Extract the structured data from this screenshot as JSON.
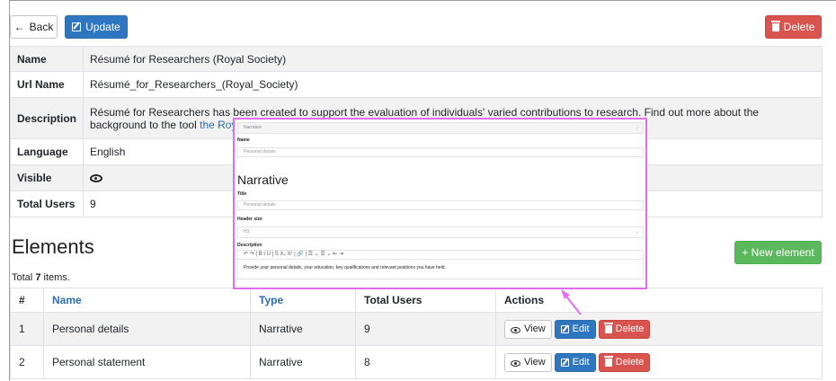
{
  "toolbar": {
    "back_label": "Back",
    "update_label": "Update",
    "delete_label": "Delete"
  },
  "details": {
    "name_label": "Name",
    "name_value": "Résumé for Researchers (Royal Society)",
    "url_label": "Url Name",
    "url_value": "Résumé_for_Researchers_(Royal_Society)",
    "desc_label": "Description",
    "desc_text": "Résumé for Researchers has been created to support the evaluation of individuals' varied contributions to research. Find out more about the background to the tool",
    "desc_link": "the Royal Society's blog",
    "desc_end": ".",
    "lang_label": "Language",
    "lang_value": "English",
    "visible_label": "Visible",
    "visible_icon": "eye-icon",
    "users_label": "Total Users",
    "users_value": "9"
  },
  "elements": {
    "heading": "Elements",
    "total_prefix": "Total",
    "total_count": "7",
    "total_suffix": "items.",
    "new_button": "+ New element",
    "columns": [
      "#",
      "Name",
      "Type",
      "Total Users",
      "Actions"
    ],
    "rows": [
      {
        "num": "1",
        "name": "Personal details",
        "type": "Narrative",
        "users": "9"
      },
      {
        "num": "2",
        "name": "Personal statement",
        "type": "Narrative",
        "users": "8"
      }
    ],
    "view_label": "View",
    "edit_label": "Edit",
    "delete_label": "Delete"
  },
  "overlay": {
    "select_value": "Narrative",
    "name_label": "Name",
    "name_value": "Personal details",
    "heading": "Narrative",
    "title_label": "Title",
    "title_value": "Personal details",
    "header_size_label": "Header size",
    "header_size_value": "H3",
    "description_label": "Description",
    "toolbar_glyphs": "↶  ↷  |  B   I   U   |  S  X₂  X²  |  🔗  |  ☰ ⌄  ☰ ⌄  ⇤  ⇥",
    "description_text": "Provide your personal details, your education, key qualifications and relevant positions you have held."
  },
  "colors": {
    "primary": "#2f76c0",
    "danger": "#d9534f",
    "success": "#5cb85c",
    "overlay_border": "#e46cf0"
  }
}
